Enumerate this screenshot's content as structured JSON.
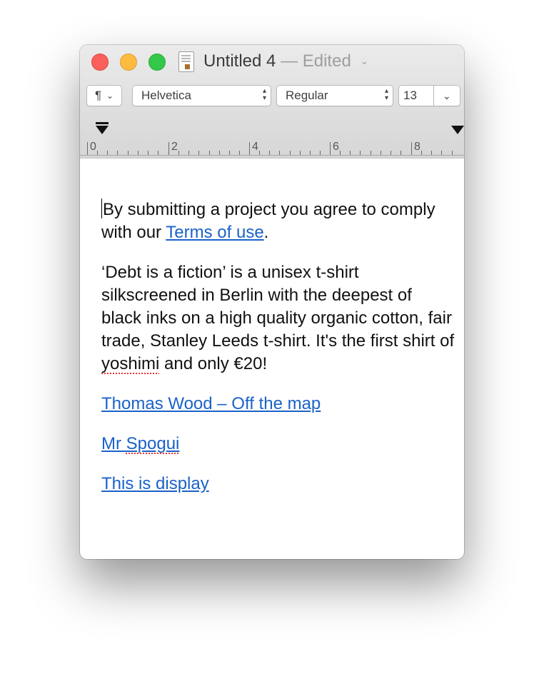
{
  "window": {
    "title": "Untitled 4",
    "title_separator": "—",
    "status": "Edited",
    "status_chevron": "⌄"
  },
  "toolbar": {
    "paragraph_icon": "¶",
    "paragraph_chevron": "⌄",
    "font_family": "Helvetica",
    "font_style": "Regular",
    "font_size": "13",
    "size_chevron": "⌄",
    "stepper_glyph_up": "▴",
    "stepper_glyph_down": "▾"
  },
  "ruler": {
    "labels": [
      "0",
      "2",
      "4",
      "6",
      "8"
    ]
  },
  "document": {
    "p1_text": "By submitting a project you agree to comply with our ",
    "p1_link": "Terms of use",
    "p1_end": ".",
    "p2_before": "‘Debt is a fiction’ is a unisex t-shirt silkscreened in Berlin with the deepest of black inks on a high quality organic cotton, fair trade, Stanley Leeds t-shirt. It's the first shirt of ",
    "p2_misspelled": "yoshimi",
    "p2_after": " and only €20!",
    "link1": "Thomas Wood – Off the map",
    "link2_prefix": "Mr ",
    "link2_misspelled": "Spogui",
    "link3": "This is display"
  },
  "colors": {
    "link": "#1a62c8",
    "close": "#fc605c",
    "minimize": "#fdbc40",
    "zoom": "#34c84a",
    "spellcheck": "#e33333"
  }
}
